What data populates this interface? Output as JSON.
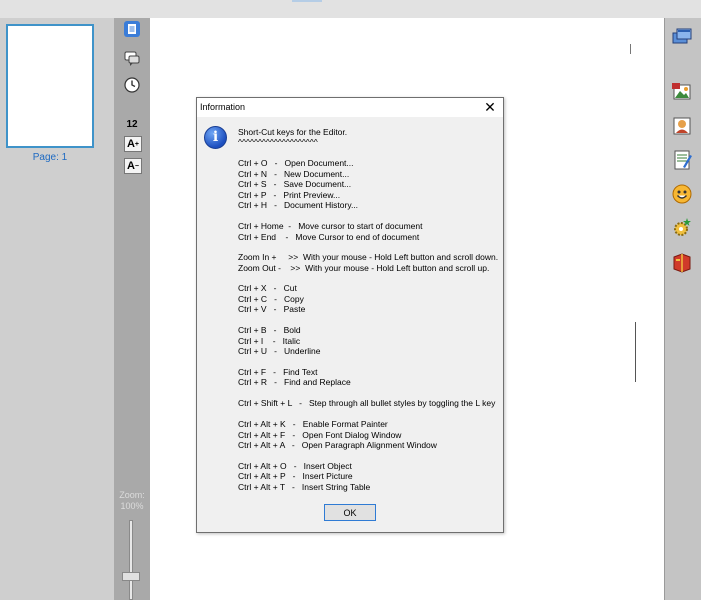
{
  "thumbnails": {
    "page_label": "Page: 1"
  },
  "tools": {
    "font_size": "12",
    "font_up_glyph": "A",
    "font_up_sup": "+",
    "font_down_glyph": "A",
    "font_down_sup": "−"
  },
  "zoom": {
    "label": "Zoom:",
    "value": "100%"
  },
  "dialog": {
    "title": "Information",
    "close_glyph": "✕",
    "icon_glyph": "i",
    "heading": "Short-Cut keys for the Editor.",
    "underline": "^^^^^^^^^^^^^^^^^^^^",
    "lines": [
      "Ctrl + O   -   Open Document...",
      "Ctrl + N   -   New Document...",
      "Ctrl + S   -   Save Document...",
      "Ctrl + P   -   Print Preview...",
      "Ctrl + H   -   Document History...",
      "Ctrl + Home  -   Move cursor to start of document",
      "Ctrl + End    -   Move Cursor to end of document",
      "Zoom In +     >>  With your mouse - Hold Left button and scroll down.",
      "Zoom Out -    >>  With your mouse - Hold Left button and scroll up.",
      "Ctrl + X   -   Cut",
      "Ctrl + C   -   Copy",
      "Ctrl + V   -   Paste",
      "Ctrl + B   -   Bold",
      "Ctrl + I    -   Italic",
      "Ctrl + U   -   Underline",
      "Ctrl + F   -   Find Text",
      "Ctrl + R   -   Find and Replace",
      "Ctrl + Shift + L   -   Step through all bullet styles by toggling the L key",
      "Ctrl + Alt + K   -   Enable Format Painter",
      "Ctrl + Alt + F   -   Open Font Dialog Window",
      "Ctrl + Alt + A   -   Open Paragraph Alignment Window",
      "Ctrl + Alt + O   -   Insert Object",
      "Ctrl + Alt + P   -   Insert Picture",
      "Ctrl + Alt + T   -   Insert String Table"
    ],
    "ok_label": "OK"
  },
  "colors": {
    "accent": "#3f93c9",
    "dialog_bg": "#f0f0f0",
    "page_label": "#1e6ac2"
  },
  "icons": {
    "toolstrip": [
      "page-view-icon",
      "comment-icon",
      "history-clock-icon",
      "font-increase-icon",
      "font-decrease-icon"
    ],
    "right_panel": [
      "windows-icon",
      "insert-picture-icon",
      "insert-image-icon",
      "notepad-icon",
      "smiley-icon",
      "gear-star-icon",
      "book-icon"
    ]
  }
}
